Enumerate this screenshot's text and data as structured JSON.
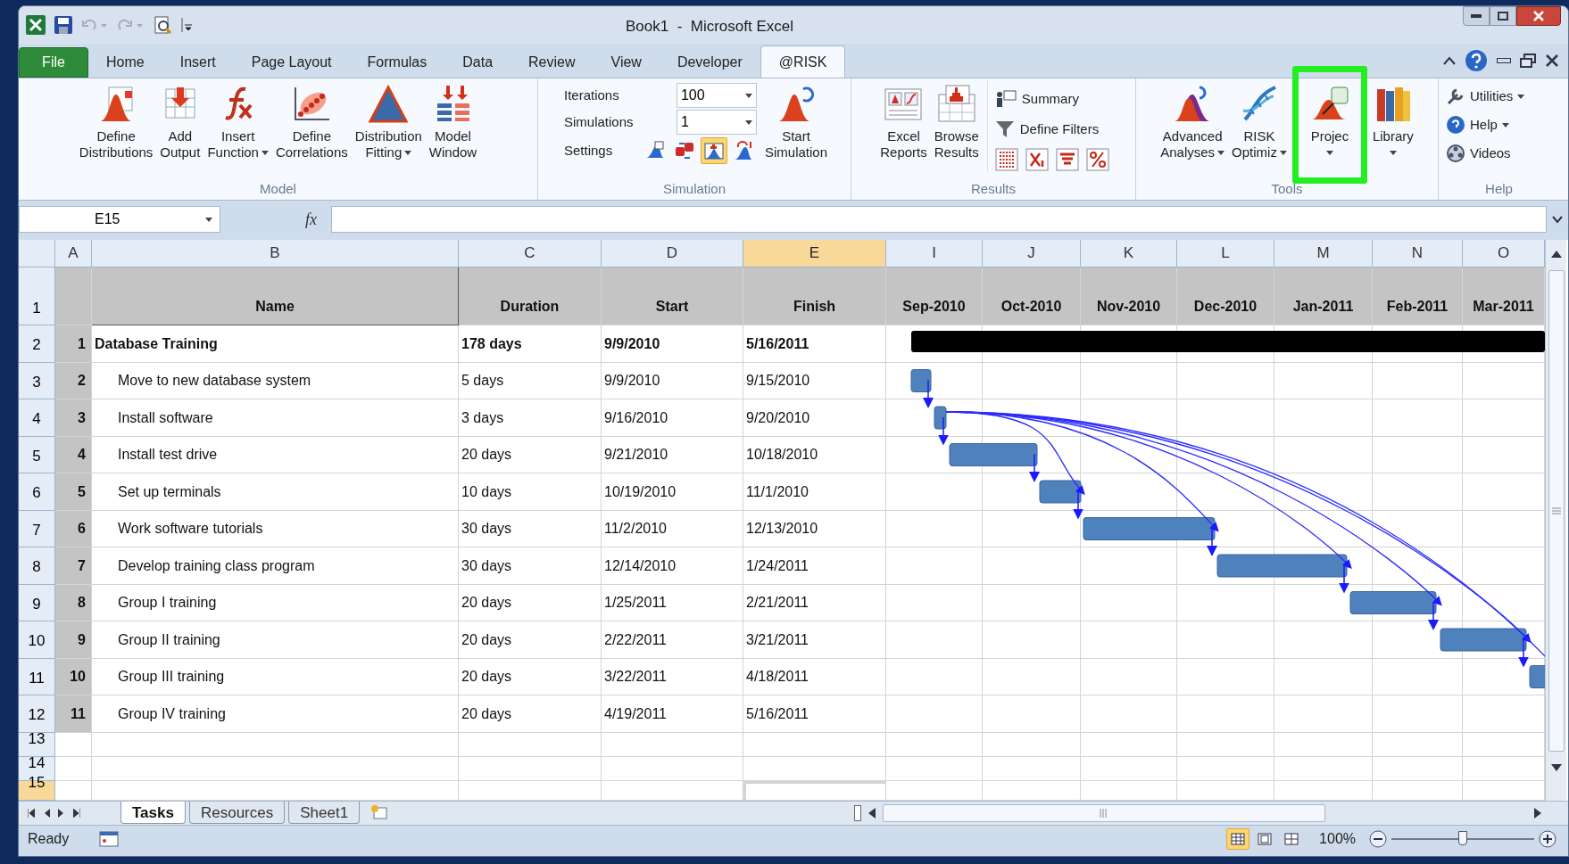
{
  "window": {
    "title": "Book1  -  Microsoft Excel"
  },
  "ribbon_tabs": [
    {
      "label": "File",
      "kind": "file",
      "selected": false
    },
    {
      "label": "Home",
      "kind": "tab",
      "selected": false
    },
    {
      "label": "Insert",
      "kind": "tab",
      "selected": false
    },
    {
      "label": "Page Layout",
      "kind": "tab",
      "selected": false
    },
    {
      "label": "Formulas",
      "kind": "tab",
      "selected": false
    },
    {
      "label": "Data",
      "kind": "tab",
      "selected": false
    },
    {
      "label": "Review",
      "kind": "tab",
      "selected": false
    },
    {
      "label": "View",
      "kind": "tab",
      "selected": false
    },
    {
      "label": "Developer",
      "kind": "tab",
      "selected": false
    },
    {
      "label": "@RISK",
      "kind": "tab",
      "selected": true
    }
  ],
  "ribbon": {
    "model": {
      "label": "Model",
      "buttons": [
        {
          "lines": [
            "Define",
            "Distributions"
          ],
          "dropdown": false
        },
        {
          "lines": [
            "Add",
            "Output"
          ],
          "dropdown": false
        },
        {
          "lines": [
            "Insert",
            "Function"
          ],
          "dropdown": true
        },
        {
          "lines": [
            "Define",
            "Correlations"
          ],
          "dropdown": false
        },
        {
          "lines": [
            "Distribution",
            "Fitting"
          ],
          "dropdown": true
        },
        {
          "lines": [
            "Model",
            "Window"
          ],
          "dropdown": false
        }
      ]
    },
    "simulation": {
      "label": "Simulation",
      "iterations": {
        "label": "Iterations",
        "value": "100"
      },
      "simulations": {
        "label": "Simulations",
        "value": "1"
      },
      "settings": {
        "label": "Settings",
        "buttons": [
          {
            "selected": false
          },
          {
            "selected": false
          },
          {
            "selected": true
          },
          {
            "selected": false
          }
        ]
      },
      "start": {
        "lines": [
          "Start",
          "Simulation"
        ]
      }
    },
    "results": {
      "label": "Results",
      "buttons": [
        {
          "lines": [
            "Excel",
            "Reports"
          ]
        },
        {
          "lines": [
            "Browse",
            "Results"
          ]
        }
      ],
      "small_buttons": [
        "Summary",
        "Define Filters"
      ]
    },
    "tools": {
      "label": "Tools",
      "buttons": [
        {
          "lines": [
            "Advanced",
            "Analyses"
          ],
          "dropdown": true,
          "highlighted": false
        },
        {
          "lines": [
            "RISK",
            "Optimiz"
          ],
          "dropdown": true,
          "highlighted": false
        },
        {
          "lines": [
            "Projec"
          ],
          "dropdown": true,
          "highlighted": true
        },
        {
          "lines": [
            "Library"
          ],
          "dropdown": true,
          "highlighted": false
        }
      ]
    },
    "help": {
      "label": "Help",
      "items": [
        {
          "label": "Utilities",
          "dropdown": true
        },
        {
          "label": "Help",
          "dropdown": true
        },
        {
          "label": "Videos",
          "dropdown": false
        }
      ]
    }
  },
  "formula_bar": {
    "name_box": "E15",
    "fx": "fx"
  },
  "columns": [
    {
      "label": "A",
      "selected": false
    },
    {
      "label": "B",
      "selected": false
    },
    {
      "label": "C",
      "selected": false
    },
    {
      "label": "D",
      "selected": false
    },
    {
      "label": "E",
      "selected": true
    },
    {
      "label": "I",
      "selected": false
    },
    {
      "label": "J",
      "selected": false
    },
    {
      "label": "K",
      "selected": false
    },
    {
      "label": "L",
      "selected": false
    },
    {
      "label": "M",
      "selected": false
    },
    {
      "label": "N",
      "selected": false
    },
    {
      "label": "O",
      "selected": false
    }
  ],
  "row_headers": [
    {
      "label": "1",
      "selected": false
    },
    {
      "label": "2",
      "selected": false
    },
    {
      "label": "3",
      "selected": false
    },
    {
      "label": "4",
      "selected": false
    },
    {
      "label": "5",
      "selected": false
    },
    {
      "label": "6",
      "selected": false
    },
    {
      "label": "7",
      "selected": false
    },
    {
      "label": "8",
      "selected": false
    },
    {
      "label": "9",
      "selected": false
    },
    {
      "label": "10",
      "selected": false
    },
    {
      "label": "11",
      "selected": false
    },
    {
      "label": "12",
      "selected": false
    },
    {
      "label": "13",
      "selected": false
    },
    {
      "label": "14",
      "selected": false
    },
    {
      "label": "15",
      "selected": true
    }
  ],
  "header_row": {
    "name": "Name",
    "duration": "Duration",
    "start": "Start",
    "finish": "Finish",
    "months": [
      "Sep-2010",
      "Oct-2010",
      "Nov-2010",
      "Dec-2010",
      "Jan-2011",
      "Feb-2011",
      "Mar-2011"
    ]
  },
  "tasks": [
    {
      "id": "1",
      "name": "Database Training",
      "duration": "178 days",
      "start": "9/9/2010",
      "finish": "5/16/2011",
      "summary": true
    },
    {
      "id": "2",
      "name": "Move to new database system",
      "duration": "5 days",
      "start": "9/9/2010",
      "finish": "9/15/2010",
      "summary": false
    },
    {
      "id": "3",
      "name": "Install software",
      "duration": "3 days",
      "start": "9/16/2010",
      "finish": "9/20/2010",
      "summary": false
    },
    {
      "id": "4",
      "name": "Install test drive",
      "duration": "20 days",
      "start": "9/21/2010",
      "finish": "10/18/2010",
      "summary": false
    },
    {
      "id": "5",
      "name": "Set up terminals",
      "duration": "10 days",
      "start": "10/19/2010",
      "finish": "11/1/2010",
      "summary": false
    },
    {
      "id": "6",
      "name": "Work software tutorials",
      "duration": "30 days",
      "start": "11/2/2010",
      "finish": "12/13/2010",
      "summary": false
    },
    {
      "id": "7",
      "name": "Develop training class program",
      "duration": "30 days",
      "start": "12/14/2010",
      "finish": "1/24/2011",
      "summary": false
    },
    {
      "id": "8",
      "name": "Group I training",
      "duration": "20 days",
      "start": "1/25/2011",
      "finish": "2/21/2011",
      "summary": false
    },
    {
      "id": "9",
      "name": "Group II training",
      "duration": "20 days",
      "start": "2/22/2011",
      "finish": "3/21/2011",
      "summary": false
    },
    {
      "id": "10",
      "name": "Group III training",
      "duration": "20 days",
      "start": "3/22/2011",
      "finish": "4/18/2011",
      "summary": false
    },
    {
      "id": "11",
      "name": "Group IV training",
      "duration": "20 days",
      "start": "4/19/2011",
      "finish": "5/16/2011",
      "summary": false
    }
  ],
  "sheet_tabs": [
    {
      "label": "Tasks",
      "selected": true
    },
    {
      "label": "Resources",
      "selected": false
    },
    {
      "label": "Sheet1",
      "selected": false
    }
  ],
  "status_bar": {
    "status": "Ready",
    "view_buttons": [
      {
        "selected": true
      },
      {
        "selected": false
      },
      {
        "selected": false
      }
    ],
    "zoom": {
      "reading": "100%",
      "level": 0.5
    }
  }
}
